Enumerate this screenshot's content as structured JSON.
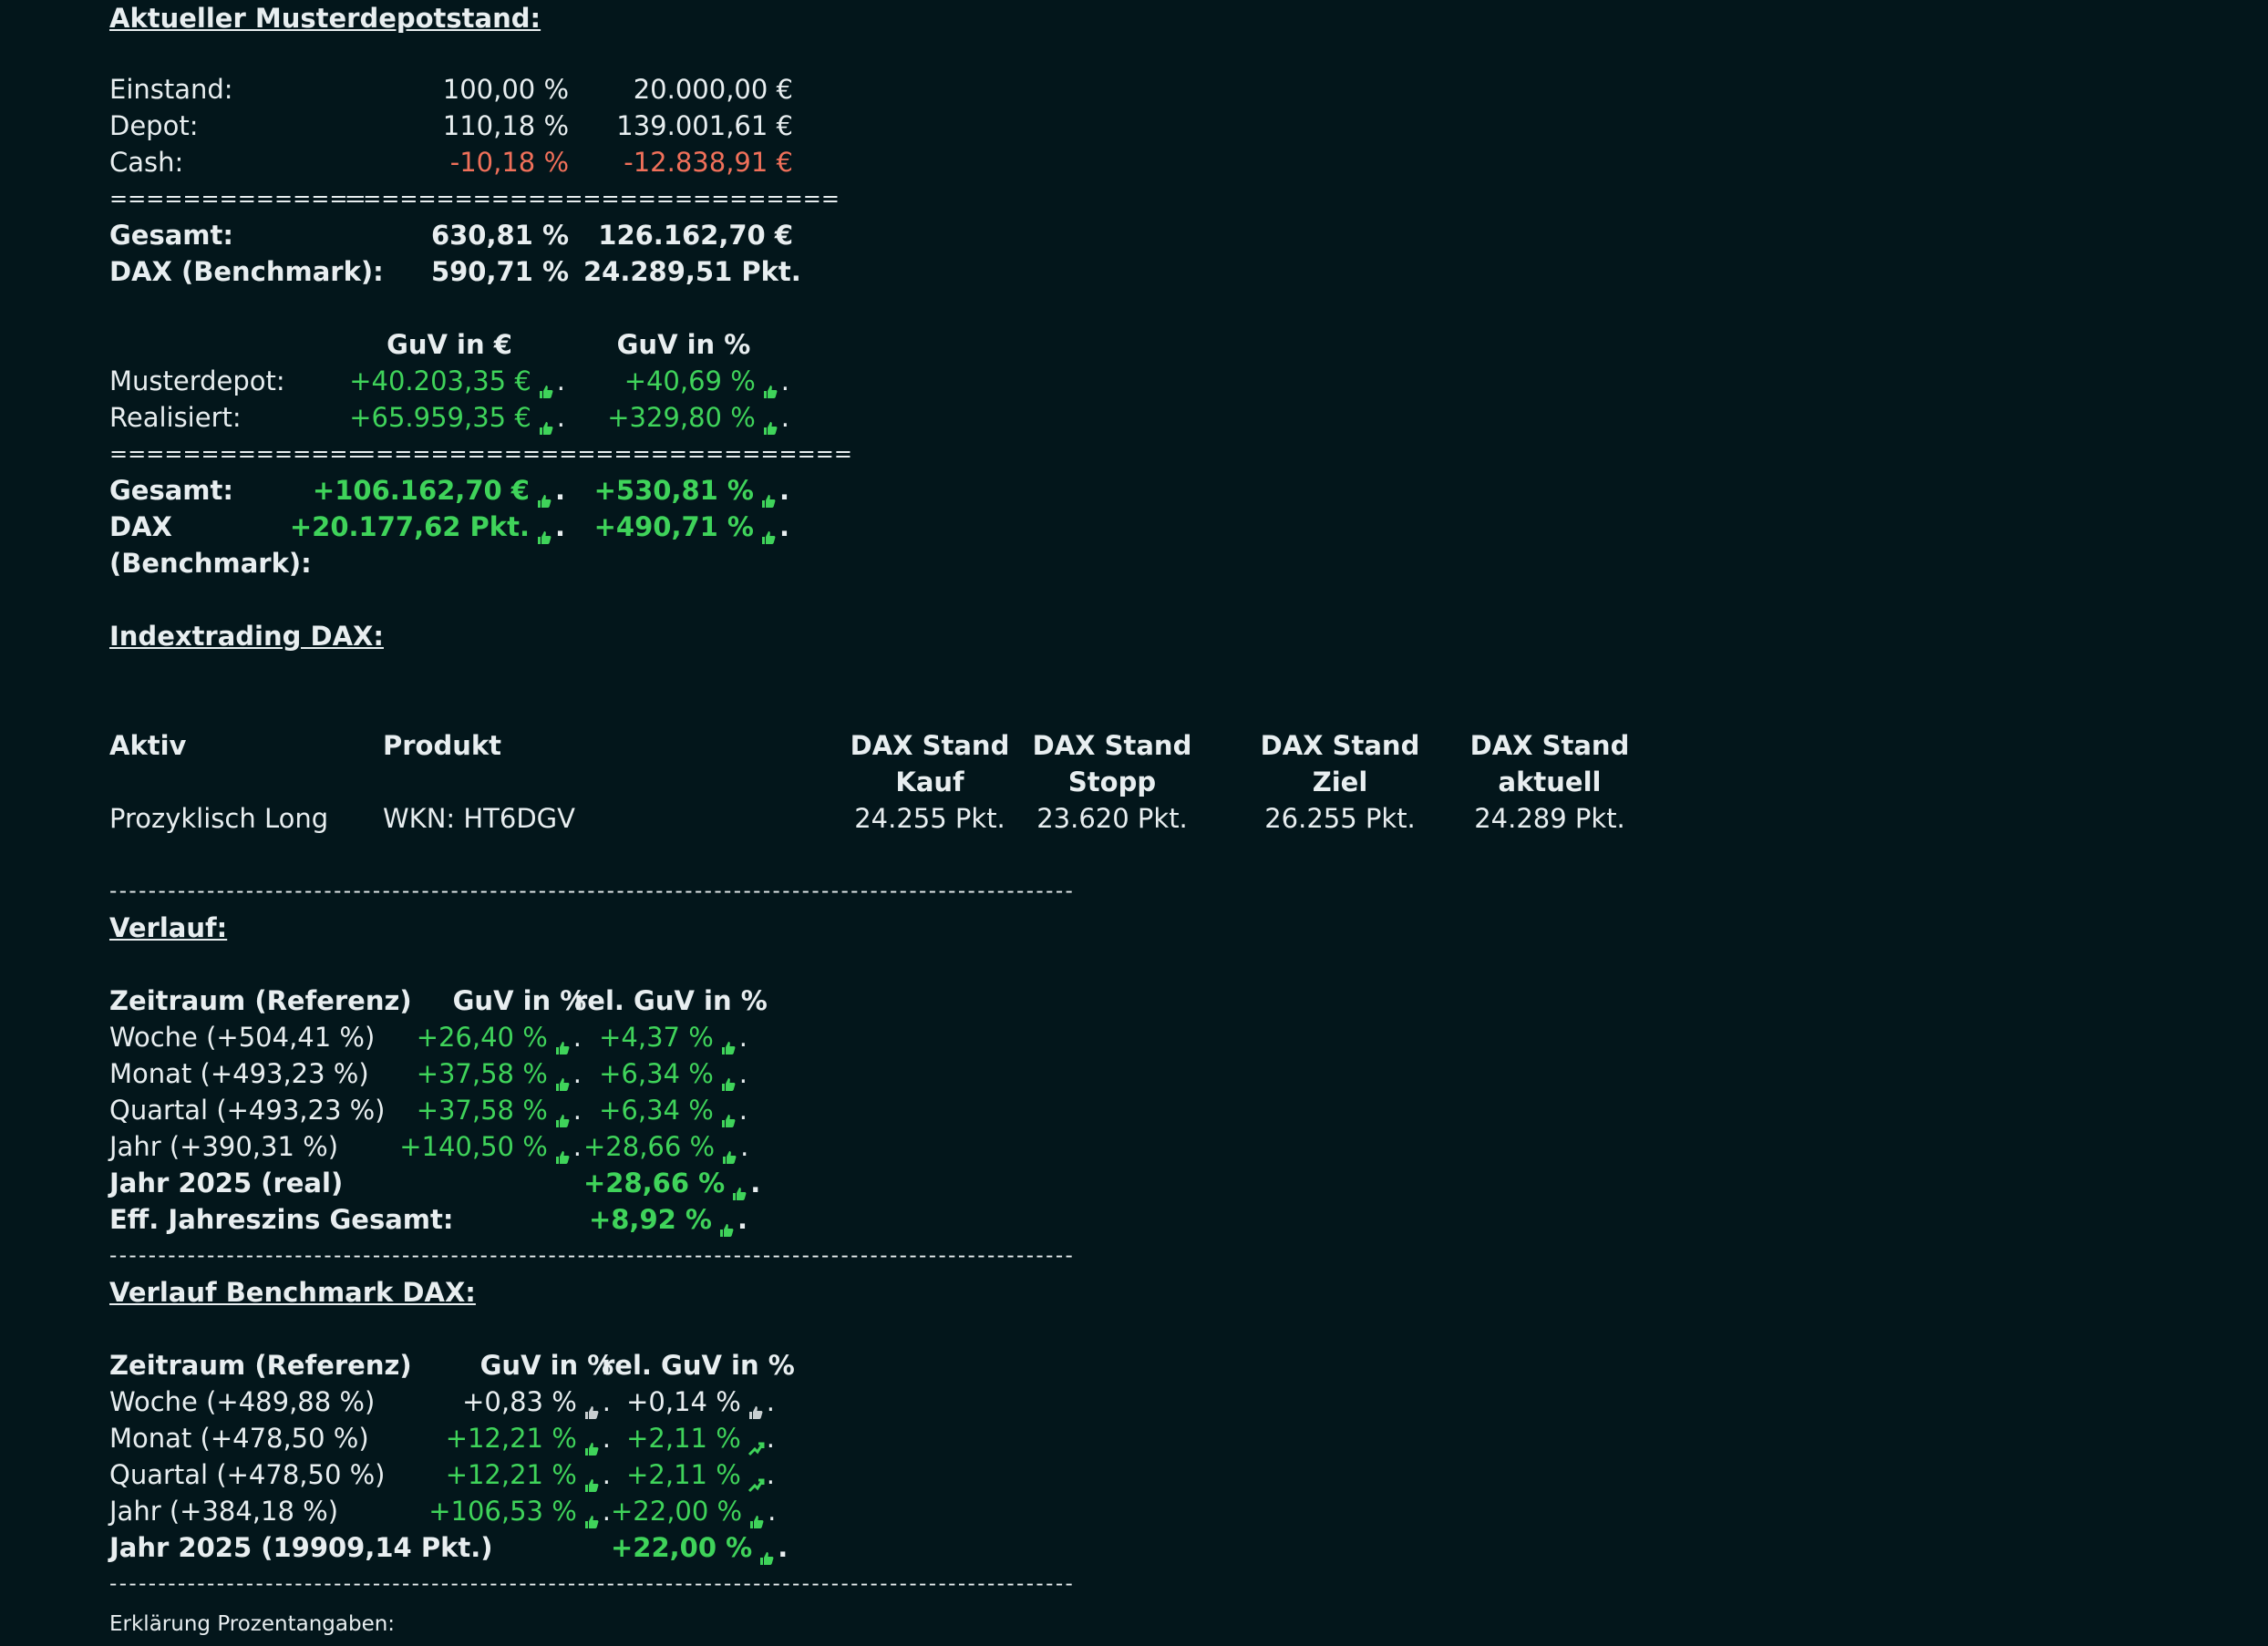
{
  "depot": {
    "heading": "Aktueller Musterdepotstand:",
    "rows": [
      {
        "label": "Einstand:",
        "pct": "100,00 %",
        "val": "20.000,00 €"
      },
      {
        "label": "Depot:",
        "pct": "110,18 %",
        "val": "139.001,61 €"
      },
      {
        "label": "Cash:",
        "pct": "-10,18 %",
        "val": "-12.838,91 €"
      }
    ],
    "sep_left": "==============",
    "sep_right": "===========================",
    "total": {
      "label": "Gesamt:",
      "pct": "630,81 %",
      "val": "126.162,70 €"
    },
    "dax": {
      "label": "DAX (Benchmark):",
      "pct": "590,71 %",
      "val": "24.289,51 Pkt."
    }
  },
  "guv": {
    "head_eur": "GuV in €",
    "head_pct": "GuV in %",
    "rows": [
      {
        "label": "Musterdepot:",
        "eur": "+40.203,35 €",
        "pct": "+40,69 %"
      },
      {
        "label": "Realisiert:",
        "eur": "+65.959,35 €",
        "pct": "+329,80 %"
      }
    ],
    "sep_left": "==============",
    "sep_right": "===========================",
    "total": {
      "label": "Gesamt:",
      "eur": "+106.162,70 €",
      "pct": "+530,81 %"
    },
    "dax": {
      "label_1": "DAX",
      "label_2": "(Benchmark):",
      "eur": "+20.177,62 Pkt.",
      "pct": "+490,71 %"
    },
    "dot": "."
  },
  "index": {
    "heading": "Indextrading DAX:",
    "cols": {
      "aktiv": "Aktiv",
      "produkt": "Produkt",
      "kauf_1": "DAX Stand",
      "kauf_2": "Kauf",
      "stopp_1": "DAX Stand",
      "stopp_2": "Stopp",
      "ziel_1": "DAX Stand",
      "ziel_2": "Ziel",
      "akt_1": "DAX Stand",
      "akt_2": "aktuell"
    },
    "row": {
      "aktiv": "Prozyklisch Long",
      "produkt": "WKN: HT6DGV",
      "kauf": "24.255 Pkt.",
      "stopp": "23.620 Pkt.",
      "ziel": "26.255 Pkt.",
      "akt": "24.289 Pkt."
    }
  },
  "dashline": "---------------------------------------------------------------------------------------------------",
  "verlauf": {
    "heading": "Verlauf:",
    "head_zeit": "Zeitraum (Referenz)",
    "head_guv": "GuV in %",
    "head_rel": "rel. GuV in %",
    "rows": [
      {
        "label": "Woche (+504,41 %)",
        "guv": "+26,40 %",
        "rel": "+4,37 %"
      },
      {
        "label": "Monat (+493,23 %)",
        "guv": "+37,58 %",
        "rel": "+6,34 %"
      },
      {
        "label": "Quartal (+493,23 %)",
        "guv": "+37,58 %",
        "rel": "+6,34 %"
      },
      {
        "label": "Jahr (+390,31 %)",
        "guv": "+140,50 %",
        "rel": "+28,66 %"
      }
    ],
    "jahr": {
      "label": "Jahr 2025 (real)",
      "rel": "+28,66 %"
    },
    "eff": {
      "label": "Eff. Jahreszins Gesamt:",
      "rel": "+8,92 %"
    }
  },
  "bench": {
    "heading": "Verlauf Benchmark DAX:",
    "head_zeit": "Zeitraum (Referenz)",
    "head_guv": "GuV in %",
    "head_rel": "rel. GuV in %",
    "rows": [
      {
        "label": "Woche (+489,88 %)",
        "guv": "+0,83 %",
        "rel": "+0,14 %",
        "guv_up": false,
        "rel_up": false
      },
      {
        "label": "Monat (+478,50 %)",
        "guv": "+12,21 %",
        "rel": "+2,11 %",
        "guv_up": true,
        "rel_up": true
      },
      {
        "label": "Quartal (+478,50 %)",
        "guv": "+12,21 %",
        "rel": "+2,11 %",
        "guv_up": true,
        "rel_up": true
      },
      {
        "label": "Jahr (+384,18 %)",
        "guv": "+106,53 %",
        "rel": "+22,00 %",
        "guv_up": true,
        "rel_up": true
      }
    ],
    "jahr": {
      "label": "Jahr 2025 (19909,14 Pkt.)",
      "rel": "+22,00 %"
    }
  },
  "footer": "Erklärung Prozentangaben:",
  "colors": {
    "bg": "#03161b",
    "text": "#e8eef0",
    "positive": "#3fd35a",
    "negative": "#f0705a"
  },
  "icons": {
    "up": "thumb-up-icon",
    "neutral": "thumb-neutral-icon"
  }
}
